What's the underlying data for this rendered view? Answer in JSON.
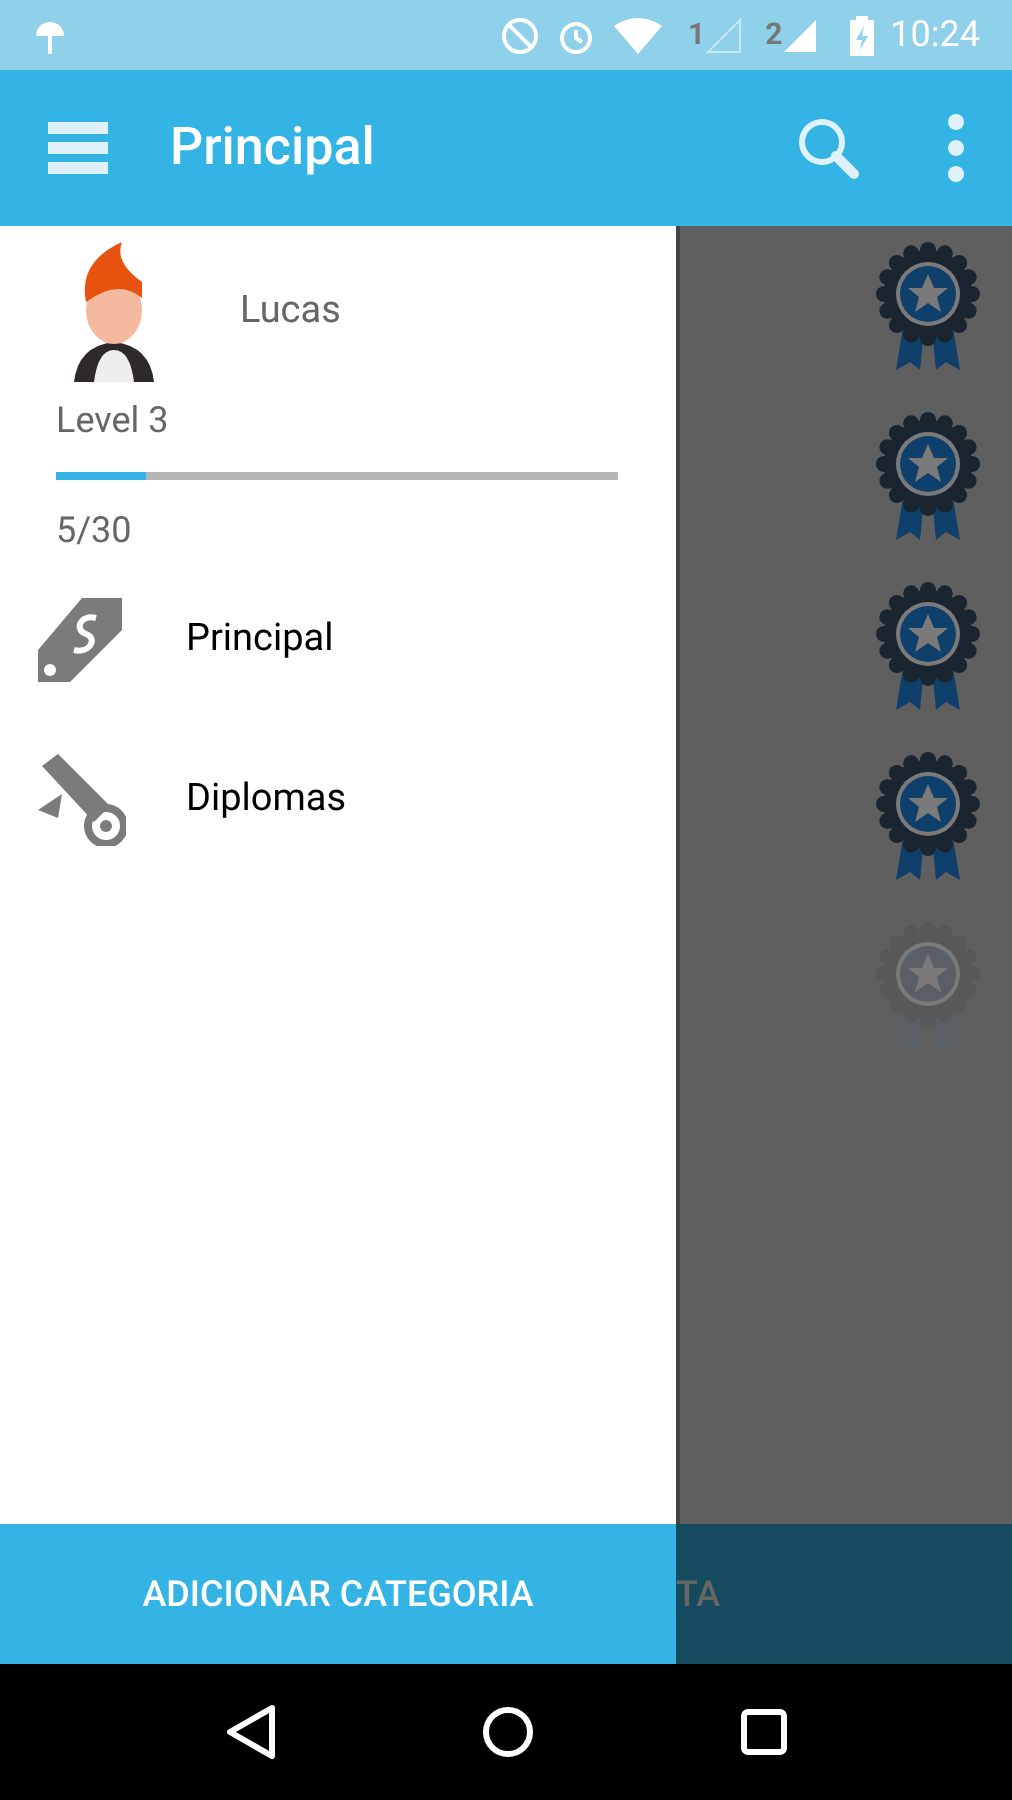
{
  "status_bar": {
    "sim_1": "1",
    "sim_2": "2",
    "time": "10:24"
  },
  "app_bar": {
    "title": "Principal"
  },
  "drawer": {
    "user": {
      "name": "Lucas",
      "level_label": "Level 3",
      "progress": {
        "level": 0.16
      },
      "points": "5/30"
    },
    "items": [
      {
        "label": "Principal",
        "kind": "tag"
      },
      {
        "label": "Diplomas",
        "kind": "diploma"
      }
    ],
    "button": "ADICIONAR CATEGORIA"
  },
  "background": {
    "badges": [
      {
        "earned": true
      },
      {
        "earned": true
      },
      {
        "earned": true
      },
      {
        "earned": true
      },
      {
        "earned": false
      }
    ],
    "bottom_button": "TA"
  }
}
